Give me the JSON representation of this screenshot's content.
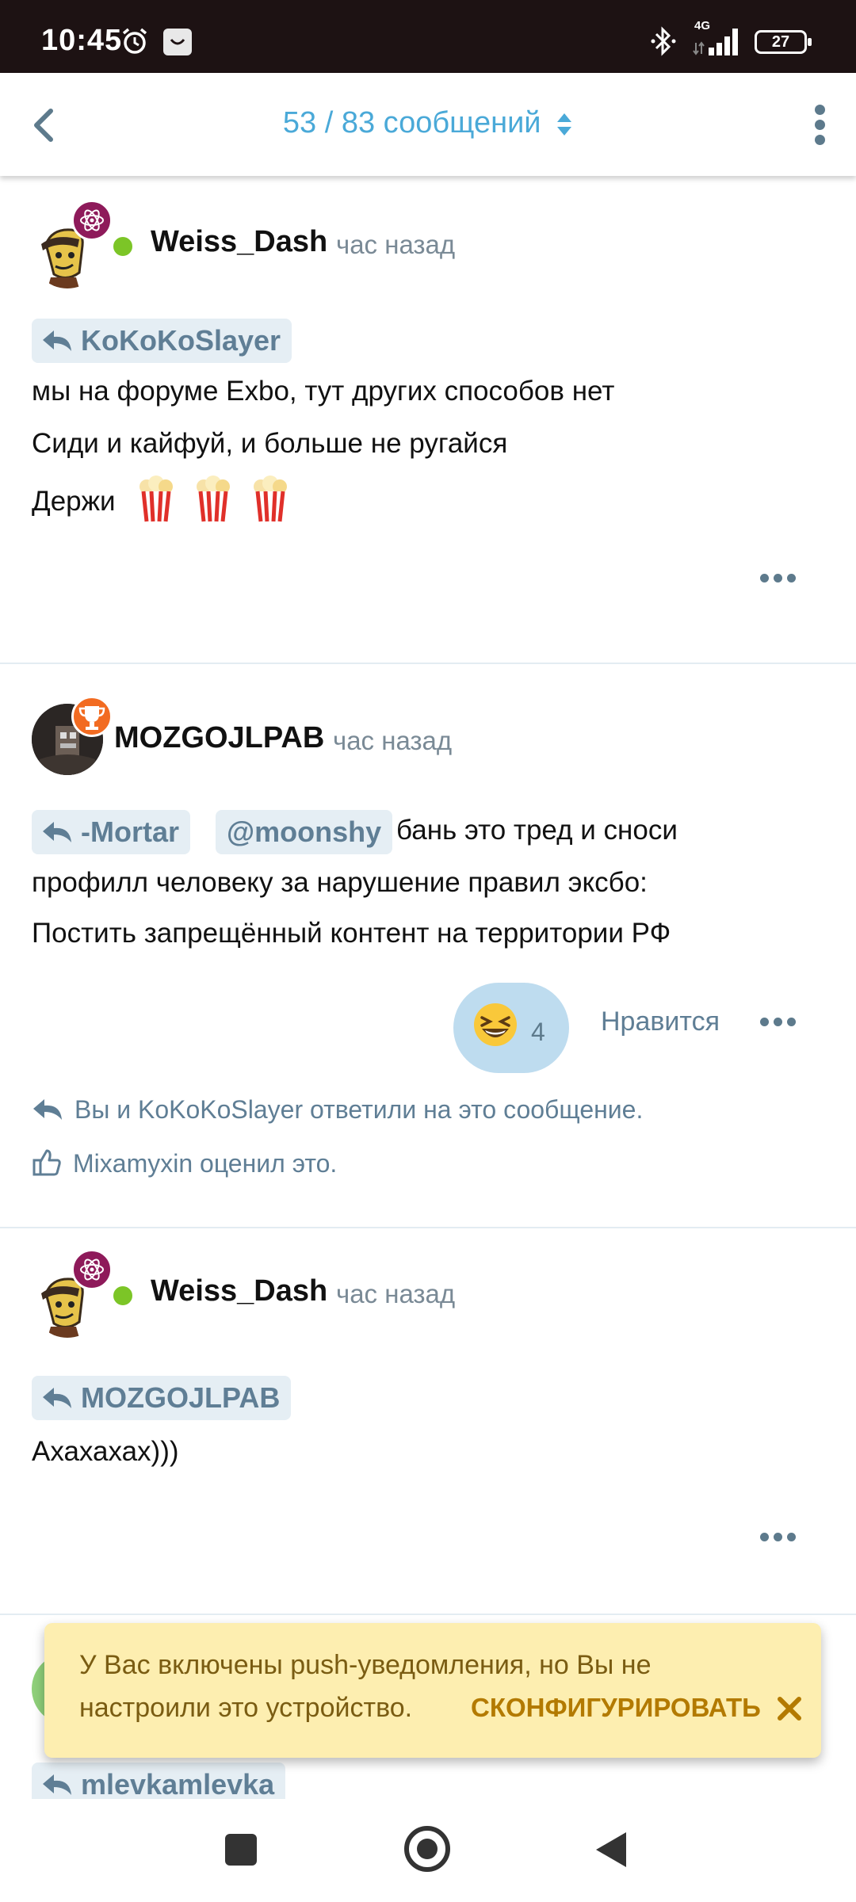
{
  "status_bar": {
    "time": "10:45",
    "network": "4G",
    "battery": "27",
    "icons": [
      "alarm-icon",
      "app-notification-icon",
      "bluetooth-icon",
      "signal-icon",
      "battery-icon"
    ]
  },
  "header": {
    "title": "53 / 83 сообщений",
    "accent_color": "#4aa9d8"
  },
  "posts": [
    {
      "author": "Weiss_Dash",
      "time": "час назад",
      "online": true,
      "badge_icon": "atom-icon",
      "reply_to": "KoKoKoSlayer",
      "lines": [
        "мы на форуме Exbo, тут других способов нет",
        "Сиди и кайфуй, и больше не ругайся",
        "Держи"
      ],
      "emojis": [
        "popcorn",
        "popcorn",
        "popcorn"
      ]
    },
    {
      "author": "MOZGOJLPAB",
      "time": "час назад",
      "badge_icon": "trophy-icon",
      "reply_to": "-Mortar",
      "mention": "@moonshy",
      "lines": [
        "бань это тред и сноси",
        "профилл человеку за нарушение правил эксбо:",
        "Постить запрещённый контент на территории РФ"
      ],
      "reaction": {
        "emoji": "laughing-face",
        "count": "4"
      },
      "like_label": "Нравится",
      "replies_note": "Вы и KoKoKoSlayer ответили на это сообщение.",
      "likes_note": "Mixamyxin оценил это."
    },
    {
      "author": "Weiss_Dash",
      "time": "час назад",
      "online": true,
      "badge_icon": "atom-icon",
      "reply_to": "MOZGOJLPAB",
      "lines": [
        "Ахахахах)))"
      ]
    },
    {
      "reply_to": "mlevkamlevka"
    }
  ],
  "toast": {
    "line1": "У Вас включены push-уведомления, но Вы не",
    "line2": "настроили это устройство.",
    "action": "СКОНФИГУРИРОВАТЬ"
  }
}
